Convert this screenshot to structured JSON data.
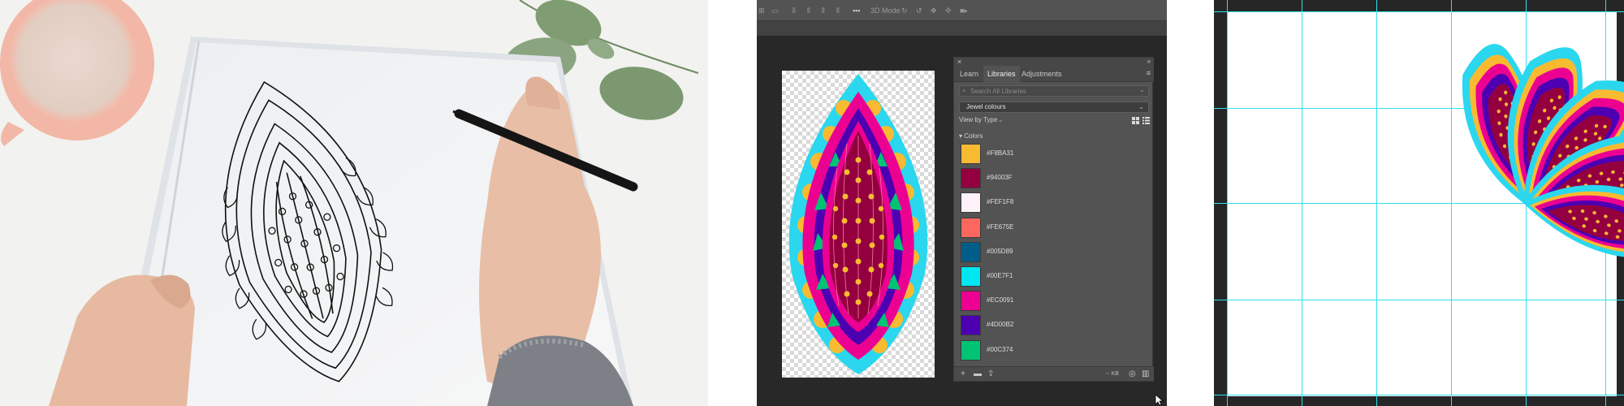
{
  "photoshop": {
    "options_bar": {
      "mode_label": "3D Mode",
      "more_icon": "ellipsis-icon"
    },
    "libraries_panel": {
      "tabs": [
        {
          "label": "Learn",
          "active": false
        },
        {
          "label": "Libraries",
          "active": true
        },
        {
          "label": "Adjustments",
          "active": false
        }
      ],
      "search_placeholder": "Search All Libraries",
      "library_name": "Jewel colours",
      "view_by_label": "View by Type",
      "section_label": "Colors",
      "colors": [
        {
          "hex": "#F8BA31",
          "label": "#F8BA31"
        },
        {
          "hex": "#94003F",
          "label": "#94003F"
        },
        {
          "hex": "#FEF1F8",
          "label": "#FEF1F8"
        },
        {
          "hex": "#FE675E",
          "label": "#FE675E"
        },
        {
          "hex": "#005D89",
          "label": "#005D89"
        },
        {
          "hex": "#00E7F1",
          "label": "#00E7F1"
        },
        {
          "hex": "#EC0091",
          "label": "#EC0091"
        },
        {
          "hex": "#4D00B2",
          "label": "#4D00B2"
        },
        {
          "hex": "#00C374",
          "label": "#00C374"
        }
      ],
      "storage_label": "-- KB"
    }
  },
  "icons": {
    "close": "close-icon",
    "collapse": "collapse-icon",
    "menu": "menu-icon",
    "search": "search-icon",
    "grid": "grid-view-icon",
    "list": "list-view-icon",
    "add": "add-icon",
    "folder": "folder-icon",
    "upload": "upload-icon",
    "sync": "sync-icon",
    "trash": "trash-icon",
    "cursor": "cursor-icon"
  }
}
